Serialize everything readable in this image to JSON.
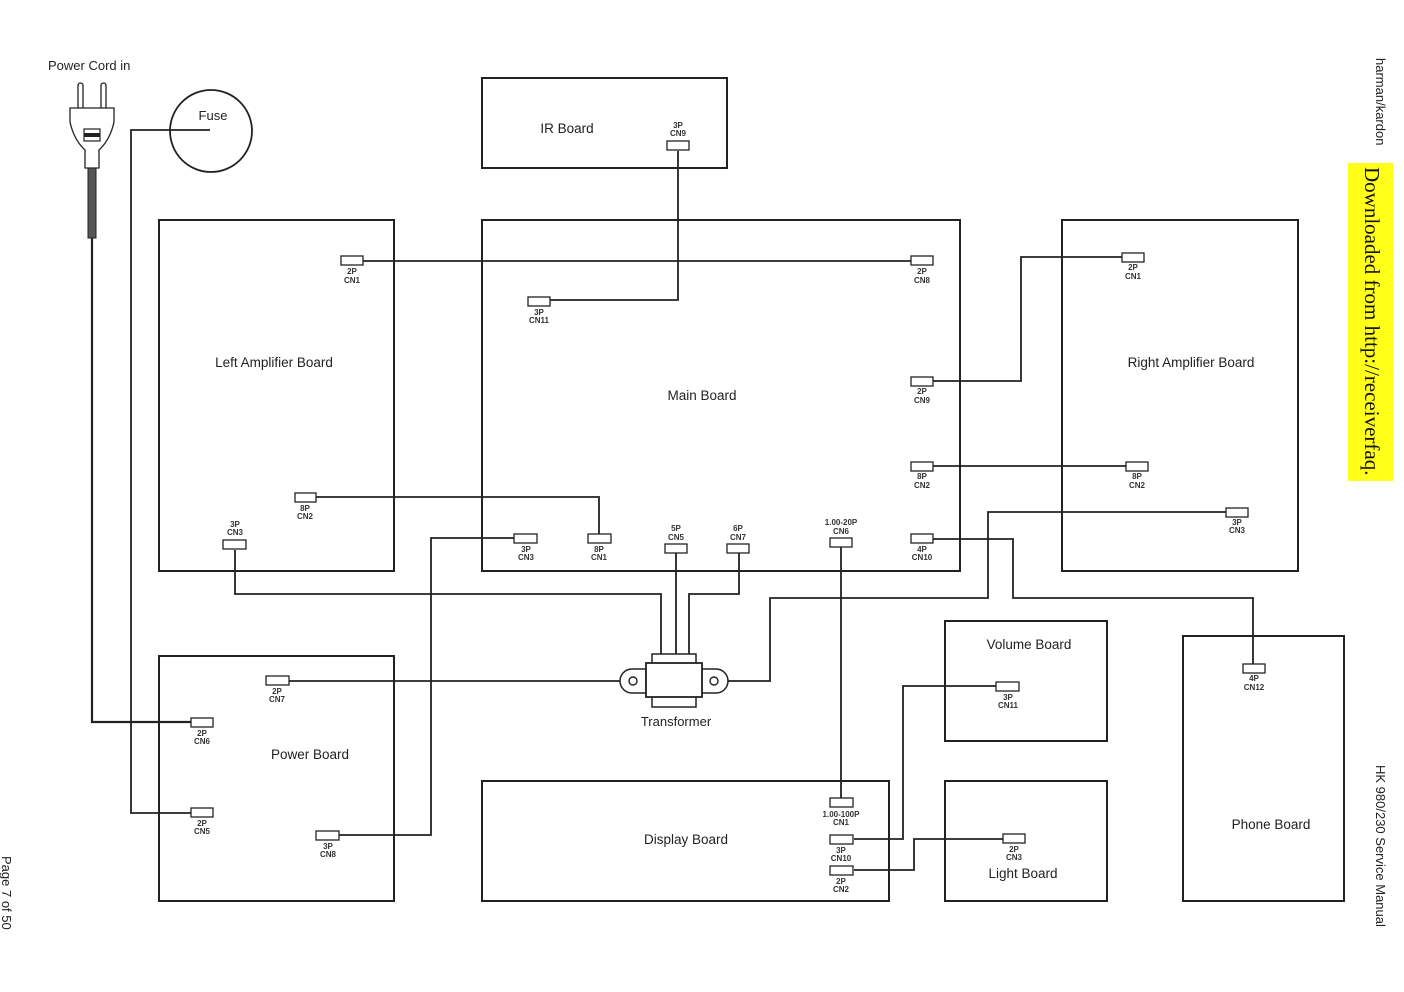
{
  "header": {
    "brand": "harman/kardon",
    "download_banner": "Downloaded from http://receiverfaq.",
    "download_banner_color": "#ffff1a",
    "manual_title": "HK 980/230 Service Manual",
    "page_label": "Page 7 of 50"
  },
  "power_cord": {
    "label": "Power Cord in",
    "icon": "power-plug-icon"
  },
  "fuse": {
    "label": "Fuse",
    "icon": "fuse-icon"
  },
  "transformer": {
    "label": "Transformer",
    "icon": "transformer-icon"
  },
  "boards": [
    {
      "id": "ir",
      "label": "IR Board",
      "connectors": [
        {
          "id": "ir-cn9",
          "pins": "3P",
          "name": "CN9"
        }
      ]
    },
    {
      "id": "left-amp",
      "label": "Left Amplifier Board",
      "connectors": [
        {
          "id": "la-cn1",
          "pins": "2P",
          "name": "CN1"
        },
        {
          "id": "la-cn2",
          "pins": "8P",
          "name": "CN2"
        },
        {
          "id": "la-cn3",
          "pins": "3P",
          "name": "CN3"
        }
      ]
    },
    {
      "id": "main",
      "label": "Main Board",
      "connectors": [
        {
          "id": "mb-cn11",
          "pins": "3P",
          "name": "CN11"
        },
        {
          "id": "mb-cn8",
          "pins": "2P",
          "name": "CN8"
        },
        {
          "id": "mb-cn9",
          "pins": "2P",
          "name": "CN9"
        },
        {
          "id": "mb-cn2",
          "pins": "8P",
          "name": "CN2"
        },
        {
          "id": "mb-cn10",
          "pins": "4P",
          "name": "CN10"
        },
        {
          "id": "mb-cn3",
          "pins": "3P",
          "name": "CN3"
        },
        {
          "id": "mb-cn1",
          "pins": "8P",
          "name": "CN1"
        },
        {
          "id": "mb-cn5",
          "pins": "5P",
          "name": "CN5"
        },
        {
          "id": "mb-cn7",
          "pins": "6P",
          "name": "CN7"
        },
        {
          "id": "mb-cn6",
          "pins": "1.00-20P",
          "name": "CN6"
        }
      ]
    },
    {
      "id": "right-amp",
      "label": "Right Amplifier Board",
      "connectors": [
        {
          "id": "ra-cn1",
          "pins": "2P",
          "name": "CN1"
        },
        {
          "id": "ra-cn2",
          "pins": "8P",
          "name": "CN2"
        },
        {
          "id": "ra-cn3",
          "pins": "3P",
          "name": "CN3"
        }
      ]
    },
    {
      "id": "power",
      "label": "Power Board",
      "connectors": [
        {
          "id": "pb-cn7",
          "pins": "2P",
          "name": "CN7"
        },
        {
          "id": "pb-cn6",
          "pins": "2P",
          "name": "CN6"
        },
        {
          "id": "pb-cn5",
          "pins": "2P",
          "name": "CN5"
        },
        {
          "id": "pb-cn8",
          "pins": "3P",
          "name": "CN8"
        }
      ]
    },
    {
      "id": "volume",
      "label": "Volume Board",
      "connectors": [
        {
          "id": "vb-cn11",
          "pins": "3P",
          "name": "CN11"
        }
      ]
    },
    {
      "id": "phone",
      "label": "Phone Board",
      "connectors": [
        {
          "id": "ph-cn12",
          "pins": "4P",
          "name": "CN12"
        }
      ]
    },
    {
      "id": "display",
      "label": "Display Board",
      "connectors": [
        {
          "id": "db-cn1",
          "pins": "1.00-100P",
          "name": "CN1"
        },
        {
          "id": "db-cn10",
          "pins": "3P",
          "name": "CN10"
        },
        {
          "id": "db-cn2",
          "pins": "2P",
          "name": "CN2"
        }
      ]
    },
    {
      "id": "light",
      "label": "Light Board",
      "connectors": [
        {
          "id": "lb-cn3",
          "pins": "2P",
          "name": "CN3"
        }
      ]
    }
  ],
  "connections": [
    {
      "from": "ir-cn9",
      "to": "mb-cn11"
    },
    {
      "from": "la-cn1",
      "to": "mb-cn8"
    },
    {
      "from": "mb-cn9",
      "to": "ra-cn1"
    },
    {
      "from": "mb-cn2",
      "to": "ra-cn2"
    },
    {
      "from": "la-cn2",
      "to": "mb-cn1"
    },
    {
      "from": "mb-cn10",
      "to": "ph-cn12"
    },
    {
      "from": "ra-cn3",
      "to": "transformer"
    },
    {
      "from": "la-cn3",
      "to": "transformer"
    },
    {
      "from": "mb-cn5",
      "to": "transformer"
    },
    {
      "from": "mb-cn7",
      "to": "transformer"
    },
    {
      "from": "pb-cn7",
      "to": "transformer"
    },
    {
      "from": "pb-cn8",
      "to": "mb-cn3"
    },
    {
      "from": "mb-cn6",
      "to": "db-cn1"
    },
    {
      "from": "db-cn10",
      "to": "vb-cn11"
    },
    {
      "from": "db-cn2",
      "to": "lb-cn3"
    },
    {
      "from": "power-cord",
      "to": "pb-cn6"
    },
    {
      "from": "fuse",
      "to": "pb-cn5"
    }
  ]
}
